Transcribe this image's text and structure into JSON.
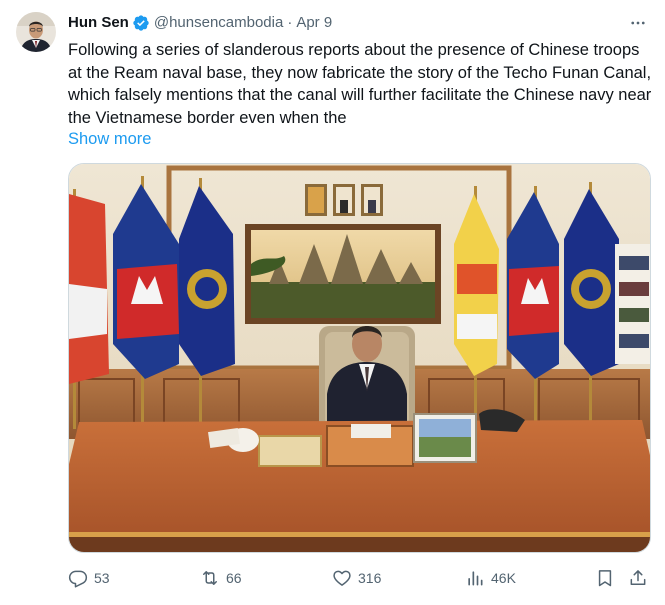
{
  "author": {
    "name": "Hun Sen",
    "handle": "@hunsencambodia",
    "separator": "·",
    "date": "Apr 9"
  },
  "tweet": {
    "text": "Following a series of slanderous reports about the presence of Chinese troops at the Ream naval base, they now fabricate the story of the Techo Funan Canal, which falsely mentions that the canal will further facilitate the Chinese navy near the Vietnamese border even when the",
    "show_more": "Show more"
  },
  "actions": {
    "replies": "53",
    "reposts": "66",
    "likes": "316",
    "views": "46K"
  },
  "icons": {
    "verified": "verified-badge-icon",
    "more": "more-horizontal-icon",
    "reply": "reply-icon",
    "repost": "repost-icon",
    "like": "heart-icon",
    "views": "views-icon",
    "bookmark": "bookmark-icon",
    "share": "share-icon"
  },
  "colors": {
    "accent": "#1d9bf0",
    "secondary_text": "#536471",
    "primary_text": "#0f1419"
  }
}
